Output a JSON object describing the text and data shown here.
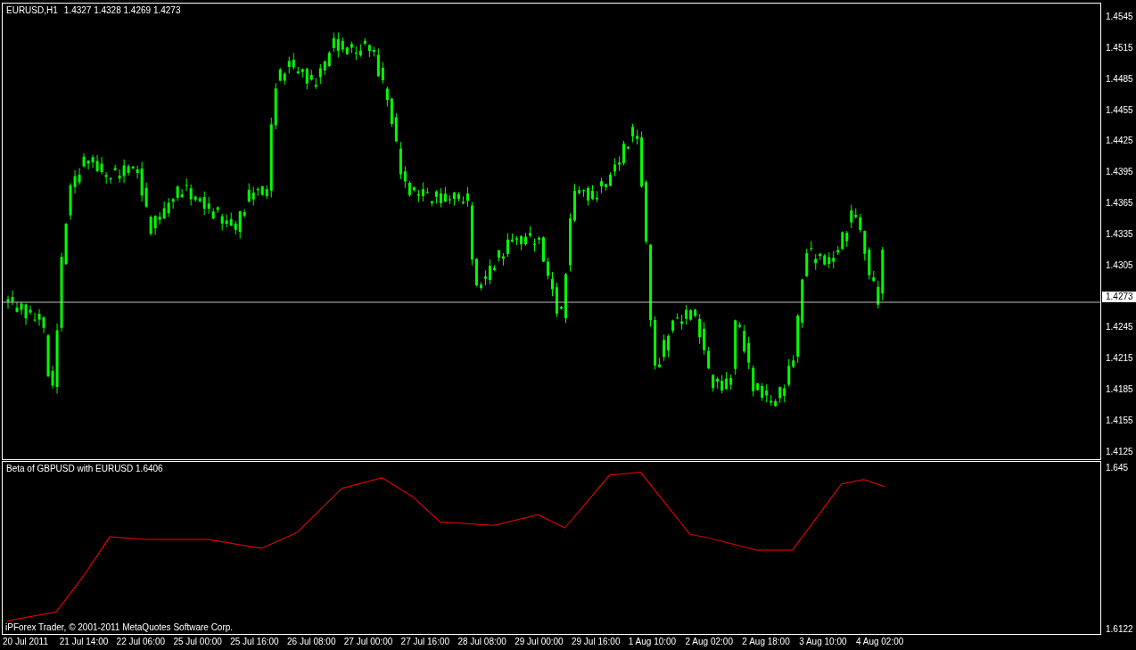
{
  "main_chart": {
    "symbol": "EURUSD,H1",
    "ohlc": "1.4327 1.4328 1.4269 1.4273",
    "current_price": "1.4273",
    "price_axis": [
      "1.4545",
      "1.4515",
      "1.4485",
      "1.4455",
      "1.4425",
      "1.4395",
      "1.4365",
      "1.4335",
      "1.4305",
      "1.4245",
      "1.4215",
      "1.4185",
      "1.4155",
      "1.4125"
    ]
  },
  "indicator": {
    "title": "Beta of GBPUSD with EURUSD 1.6406",
    "axis": [
      "1.645",
      "1.6122"
    ],
    "copyright": "iPForex Trader, © 2001-2011 MetaQuotes Software Corp."
  },
  "time_axis": [
    "20 Jul 2011",
    "21 Jul 14:00",
    "22 Jul 06:00",
    "25 Jul 00:00",
    "25 Jul 16:00",
    "26 Jul 08:00",
    "27 Jul 00:00",
    "27 Jul 16:00",
    "28 Jul 08:00",
    "29 Jul 00:00",
    "29 Jul 16:00",
    "1 Aug 10:00",
    "2 Aug 02:00",
    "2 Aug 18:00",
    "3 Aug 10:00",
    "4 Aug 02:00"
  ]
}
